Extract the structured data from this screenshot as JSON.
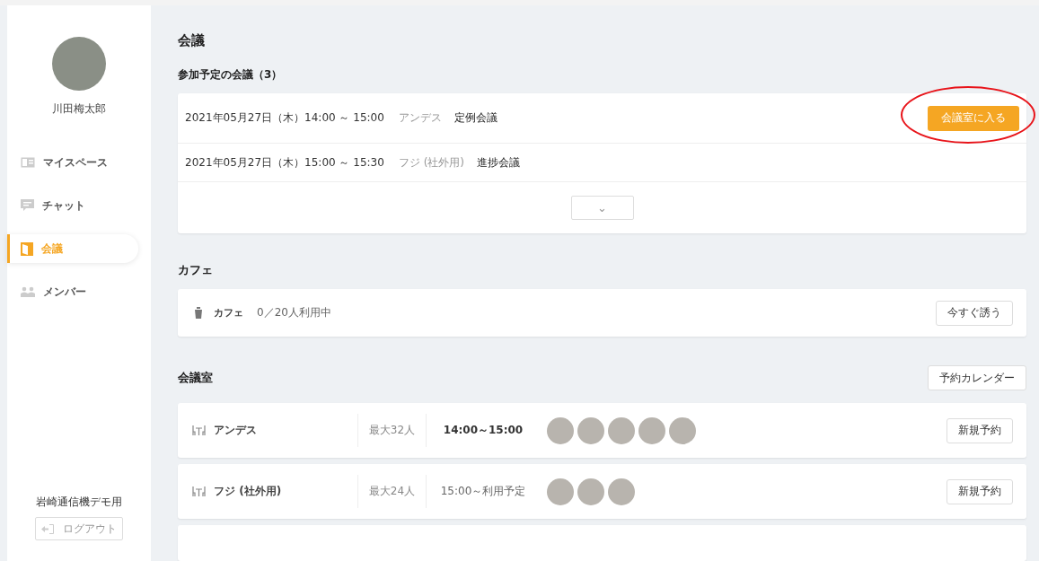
{
  "sidebar": {
    "user_name": "川田梅太郎",
    "items": [
      {
        "label": "マイスペース",
        "selected": false
      },
      {
        "label": "チャット",
        "selected": false
      },
      {
        "label": "会議",
        "selected": true
      },
      {
        "label": "メンバー",
        "selected": false
      }
    ],
    "organization": "岩崎通信機デモ用",
    "logout_button": "ログアウト"
  },
  "page_title": "会議",
  "upcoming": {
    "heading": "参加予定の会議（3）",
    "meetings": [
      {
        "datetime": "2021年05月27日（木）14:00 ～ 15:00",
        "room": "アンデス",
        "title": "定例会議",
        "action": "会議室に入る"
      },
      {
        "datetime": "2021年05月27日（木）15:00 ～ 15:30",
        "room": "フジ (社外用)",
        "title": "進捗会議"
      }
    ],
    "expand_button": "⌄"
  },
  "annotation": {
    "kind": "ellipse",
    "color": "#e8141a"
  },
  "cafe": {
    "heading": "カフェ",
    "name": "カフェ",
    "usage": "0／20人利用中",
    "button": "今すぐ誘う"
  },
  "rooms": {
    "heading": "会議室",
    "calendar_button": "予約カレンダー",
    "items": [
      {
        "name": "アンデス",
        "capacity": "最大32人",
        "time": "14:00～15:00",
        "emphasized": true,
        "attendees": [
          {
            "kind": "photo"
          },
          {
            "kind": "photo"
          },
          {
            "kind": "photo"
          },
          {
            "kind": "photo"
          },
          {
            "kind": "photo"
          }
        ],
        "button": "新規予約"
      },
      {
        "name": "フジ (社外用)",
        "capacity": "最大24人",
        "time": "15:00～利用予定",
        "emphasized": false,
        "attendees": [
          {
            "kind": "photo"
          },
          {
            "kind": "photo"
          },
          {
            "kind": "photo"
          }
        ],
        "button": "新規予約"
      }
    ]
  }
}
